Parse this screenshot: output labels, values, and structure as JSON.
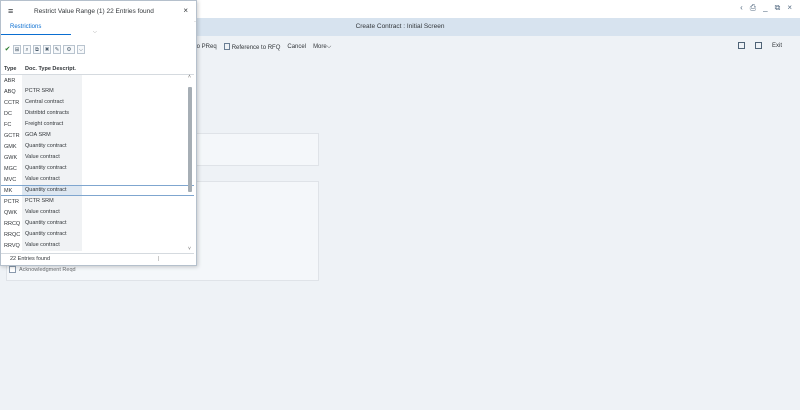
{
  "window": {
    "controls": [
      "‹",
      "⎙",
      "_",
      "⧉",
      "×"
    ]
  },
  "header": {
    "title": "Create Contract : Initial Screen"
  },
  "toolbar": {
    "items": [
      "to PReq",
      "Reference to RFQ",
      "Cancel",
      "More"
    ],
    "more_arrow": "⌵"
  },
  "right_toolbar": {
    "exit_label": "Exit"
  },
  "form": {
    "ack_label": "Acknowledgment Reqd"
  },
  "popup": {
    "title": "Restrict Value Range (1)  22 Entries found",
    "close": "×",
    "menu_icon": "≡",
    "restrictions_tab": "Restrictions",
    "tools": [
      "✔",
      "⊞",
      "⌕",
      "⧉",
      "✖",
      "✎",
      "⚙",
      "⌵"
    ],
    "columns": [
      "Type",
      "Doc. Type Descript."
    ],
    "rows": [
      [
        "ABR",
        ""
      ],
      [
        "ABQ",
        "PCTR SRM"
      ],
      [
        "CCTR",
        "Central contract"
      ],
      [
        "DC",
        "Distribtd contracts"
      ],
      [
        "FC",
        "Freight contract"
      ],
      [
        "GCTR",
        "GOA SRM"
      ],
      [
        "GMK",
        "Quantity contract"
      ],
      [
        "GWK",
        "Value contract"
      ],
      [
        "MGC",
        "Quantity contract"
      ],
      [
        "MVC",
        "Value contract"
      ],
      [
        "MK",
        "Quantity contract"
      ],
      [
        "PCTR",
        "PCTR SRM"
      ],
      [
        "QWK",
        "Value contract"
      ],
      [
        "RRCQ",
        "Quantity contract"
      ],
      [
        "RRQC",
        "Quantity contract"
      ],
      [
        "RRVQ",
        "Value contract"
      ]
    ],
    "selected_row": 10,
    "footer": "22 Entries found"
  }
}
